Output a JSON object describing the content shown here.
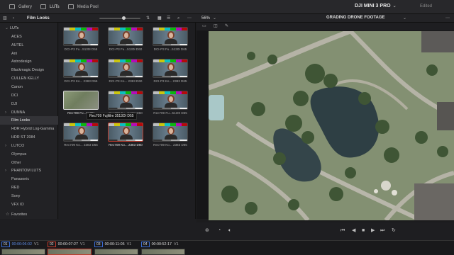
{
  "tabs": [
    {
      "label": "Gallery",
      "icon": "gallery-icon"
    },
    {
      "label": "LUTs",
      "icon": "luts-icon"
    },
    {
      "label": "Media Pool",
      "icon": "media-pool-icon"
    }
  ],
  "project": {
    "title": "DJI MINI 3 PRO",
    "status": "Edited"
  },
  "toolbar": {
    "folder_title": "Film Looks",
    "zoom_level": "56%",
    "viewer_title": "GRADING DRONE FOOTAGE",
    "zoom_fraction": 0.6
  },
  "sidebar": {
    "root": "LUTs",
    "items": [
      "ACES",
      "AUTEL",
      "Arri",
      "Astrodesign",
      "Blackmagic Design",
      "CULLEN KELLY",
      "Canon",
      "DCI",
      "DJI",
      "DUNNA",
      "Film Looks",
      "HDR Hybrid Log-Gamma",
      "HDR ST 2084",
      "LUTCO",
      "Olympus",
      "Other",
      "PHANTOM LUTS",
      "Panasonic",
      "RED",
      "Sony",
      "VFX IO"
    ],
    "expandable": [
      "DUNNA",
      "LUTCO",
      "PHANTOM LUTS"
    ],
    "selected": "Film Looks",
    "favorites": "Favorites"
  },
  "luts": [
    "DCI-P3 Fu...5130I D55",
    "DCI-P3 Fu...5130I D60",
    "DCI-P3 Fu...5130I D65",
    "DCI-P3 Ko... 2383 D55",
    "DCI-P3 Ko... 2383 D60",
    "DCI-P3 Ko... 2383 D65",
    "Rec709 Fu...5130I",
    "Rec709 Fu...5130I D60",
    "Rec709 Fu...5130I D65",
    "Rec709 Ko... 2383 D55",
    "Rec709 Ko... 2383 D60",
    "Rec709 Ko... 2383 D65"
  ],
  "tooltip": "Rec709 Fujifilm 3513DI D55",
  "timeline": {
    "clips": [
      {
        "num": "01",
        "tc": "00:00:06:02",
        "track": "V1"
      },
      {
        "num": "02",
        "tc": "00:00:07:27",
        "track": "V1"
      },
      {
        "num": "03",
        "tc": "00:00:11:05",
        "track": "V1"
      },
      {
        "num": "04",
        "tc": "00:00:52:17",
        "track": "V1"
      }
    ]
  },
  "colors": {
    "accent_blue": "#3a6ad0",
    "selected_red": "#c0392b"
  }
}
